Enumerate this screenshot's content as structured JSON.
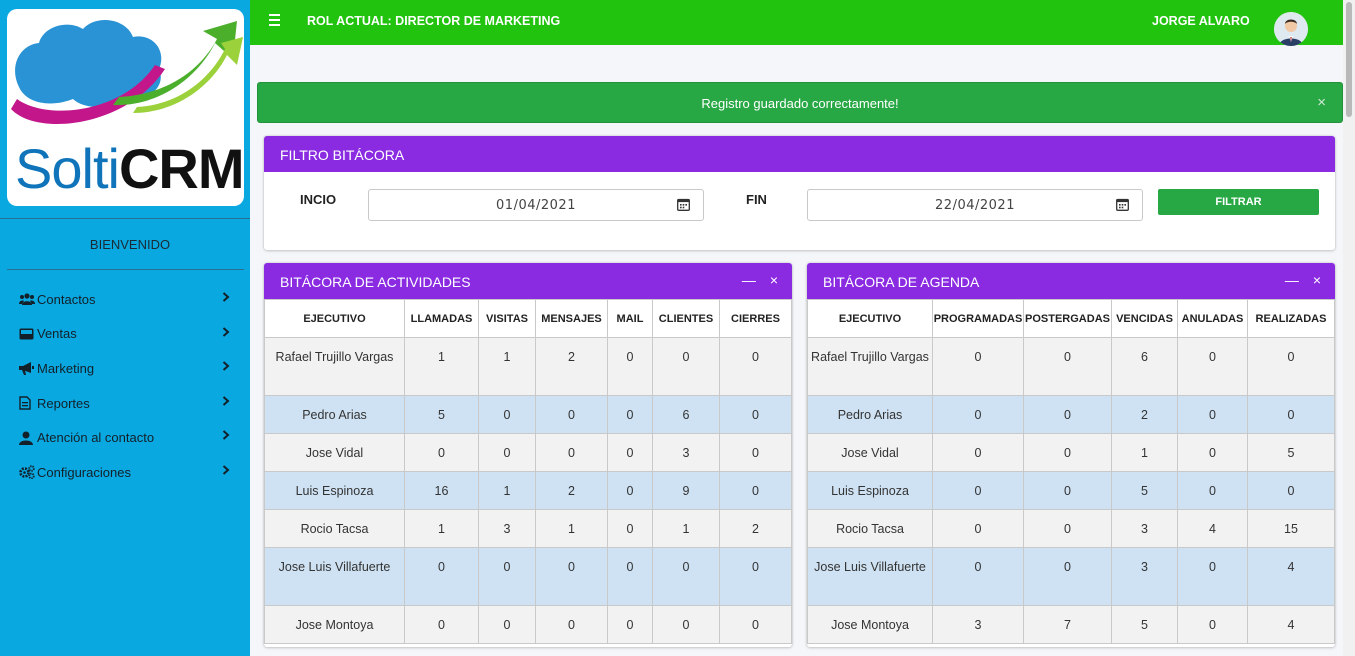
{
  "logo": {
    "part1": "Solti",
    "part2": "CRM"
  },
  "sidebar": {
    "welcome": "BIENVENIDO",
    "items": [
      {
        "label": "Contactos",
        "icon": "users-icon"
      },
      {
        "label": "Ventas",
        "icon": "inbox-icon"
      },
      {
        "label": "Marketing",
        "icon": "megaphone-icon"
      },
      {
        "label": "Reportes",
        "icon": "file-icon"
      },
      {
        "label": "Atención al contacto",
        "icon": "user-tie-icon"
      },
      {
        "label": "Configuraciones",
        "icon": "gears-icon"
      }
    ]
  },
  "topbar": {
    "role": "ROL ACTUAL: DIRECTOR DE MARKETING",
    "user": "JORGE ALVARO"
  },
  "alert": {
    "message": "Registro guardado correctamente!",
    "close": "×"
  },
  "filter": {
    "title": "FILTRO BITÁCORA",
    "start_label": "INCIO",
    "start_value": "01/04/2021",
    "end_label": "FIN",
    "end_value": "22/04/2021",
    "button": "FILTRAR"
  },
  "activities": {
    "title": "BITÁCORA DE ACTIVIDADES",
    "minimize": "—",
    "close": "×",
    "headers": [
      "EJECUTIVO",
      "LLAMADAS",
      "VISITAS",
      "MENSAJES",
      "MAIL",
      "CLIENTES",
      "CIERRES"
    ],
    "rows": [
      [
        "Rafael Trujillo Vargas",
        "1",
        "1",
        "2",
        "0",
        "0",
        "0"
      ],
      [
        "Pedro Arias",
        "5",
        "0",
        "0",
        "0",
        "6",
        "0"
      ],
      [
        "Jose Vidal",
        "0",
        "0",
        "0",
        "0",
        "3",
        "0"
      ],
      [
        "Luis Espinoza",
        "16",
        "1",
        "2",
        "0",
        "9",
        "0"
      ],
      [
        "Rocio Tacsa",
        "1",
        "3",
        "1",
        "0",
        "1",
        "2"
      ],
      [
        "Jose Luis Villafuerte",
        "0",
        "0",
        "0",
        "0",
        "0",
        "0"
      ],
      [
        "Jose Montoya",
        "0",
        "0",
        "0",
        "0",
        "0",
        "0"
      ]
    ]
  },
  "agenda": {
    "title": "BITÁCORA DE AGENDA",
    "minimize": "—",
    "close": "×",
    "headers": [
      "EJECUTIVO",
      "PROGRAMADAS",
      "POSTERGADAS",
      "VENCIDAS",
      "ANULADAS",
      "REALIZADAS"
    ],
    "rows": [
      [
        "Rafael Trujillo Vargas",
        "0",
        "0",
        "6",
        "0",
        "0"
      ],
      [
        "Pedro Arias",
        "0",
        "0",
        "2",
        "0",
        "0"
      ],
      [
        "Jose Vidal",
        "0",
        "0",
        "1",
        "0",
        "5"
      ],
      [
        "Luis Espinoza",
        "0",
        "0",
        "5",
        "0",
        "0"
      ],
      [
        "Rocio Tacsa",
        "0",
        "0",
        "3",
        "4",
        "15"
      ],
      [
        "Jose Luis Villafuerte",
        "0",
        "0",
        "3",
        "0",
        "4"
      ],
      [
        "Jose Montoya",
        "3",
        "7",
        "5",
        "0",
        "4"
      ]
    ]
  }
}
